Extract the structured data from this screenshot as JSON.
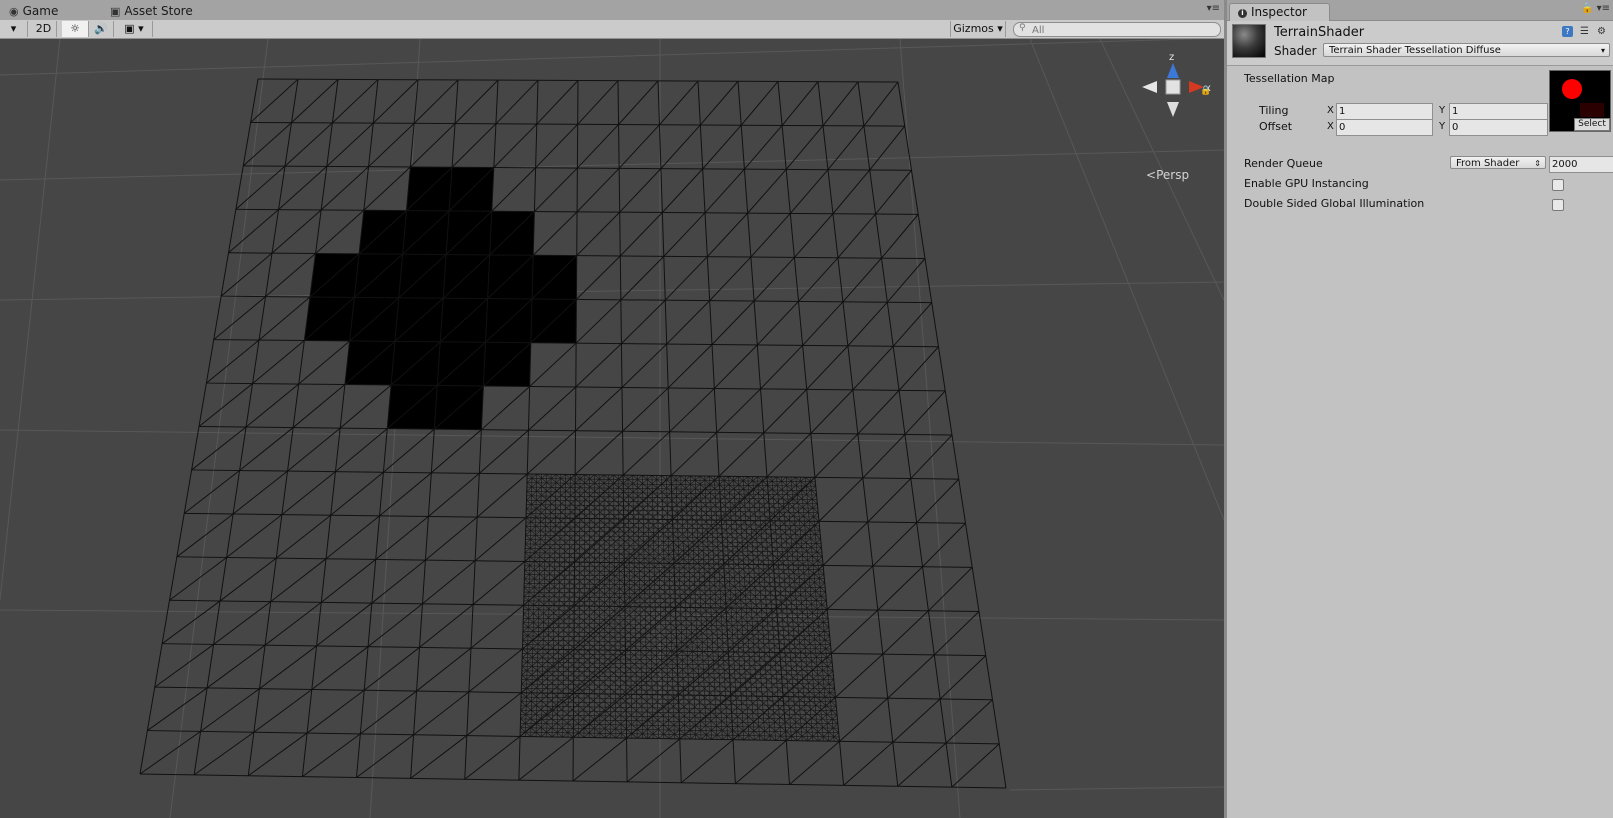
{
  "scene": {
    "tabs": [
      {
        "label": "Game",
        "icon": "game-controller-icon"
      },
      {
        "label": "Asset Store",
        "icon": "shopping-bag-icon"
      }
    ],
    "toolbar": {
      "mode_2d": "2D",
      "gizmos": "Gizmos",
      "search_placeholder": "All"
    },
    "gizmo": {
      "z_label": "z",
      "x_label": "x",
      "projection": "Persp"
    }
  },
  "inspector": {
    "tab_label": "Inspector",
    "material_name": "TerrainShader",
    "shader_label": "Shader",
    "shader_value": "Terrain Shader Tessellation Diffuse",
    "tessellation_map_label": "Tessellation Map",
    "tiling_label": "Tiling",
    "offset_label": "Offset",
    "x_label": "X",
    "y_label": "Y",
    "tiling_x": "1",
    "tiling_y": "1",
    "offset_x": "0",
    "offset_y": "0",
    "texture_select": "Select",
    "render_queue_label": "Render Queue",
    "render_queue_mode": "From Shader",
    "render_queue_value": "2000",
    "gpu_instancing_label": "Enable GPU Instancing",
    "gpu_instancing_checked": false,
    "double_sided_gi_label": "Double Sided Global Illumination",
    "double_sided_gi_checked": false
  },
  "colors": {
    "scene_background": "#464646",
    "wireframe": "#111111",
    "inspector_background": "#c2c2c2",
    "gizmo_x": "#d5391f",
    "gizmo_z": "#3c78d8",
    "tess_dot": "#ff0000"
  }
}
